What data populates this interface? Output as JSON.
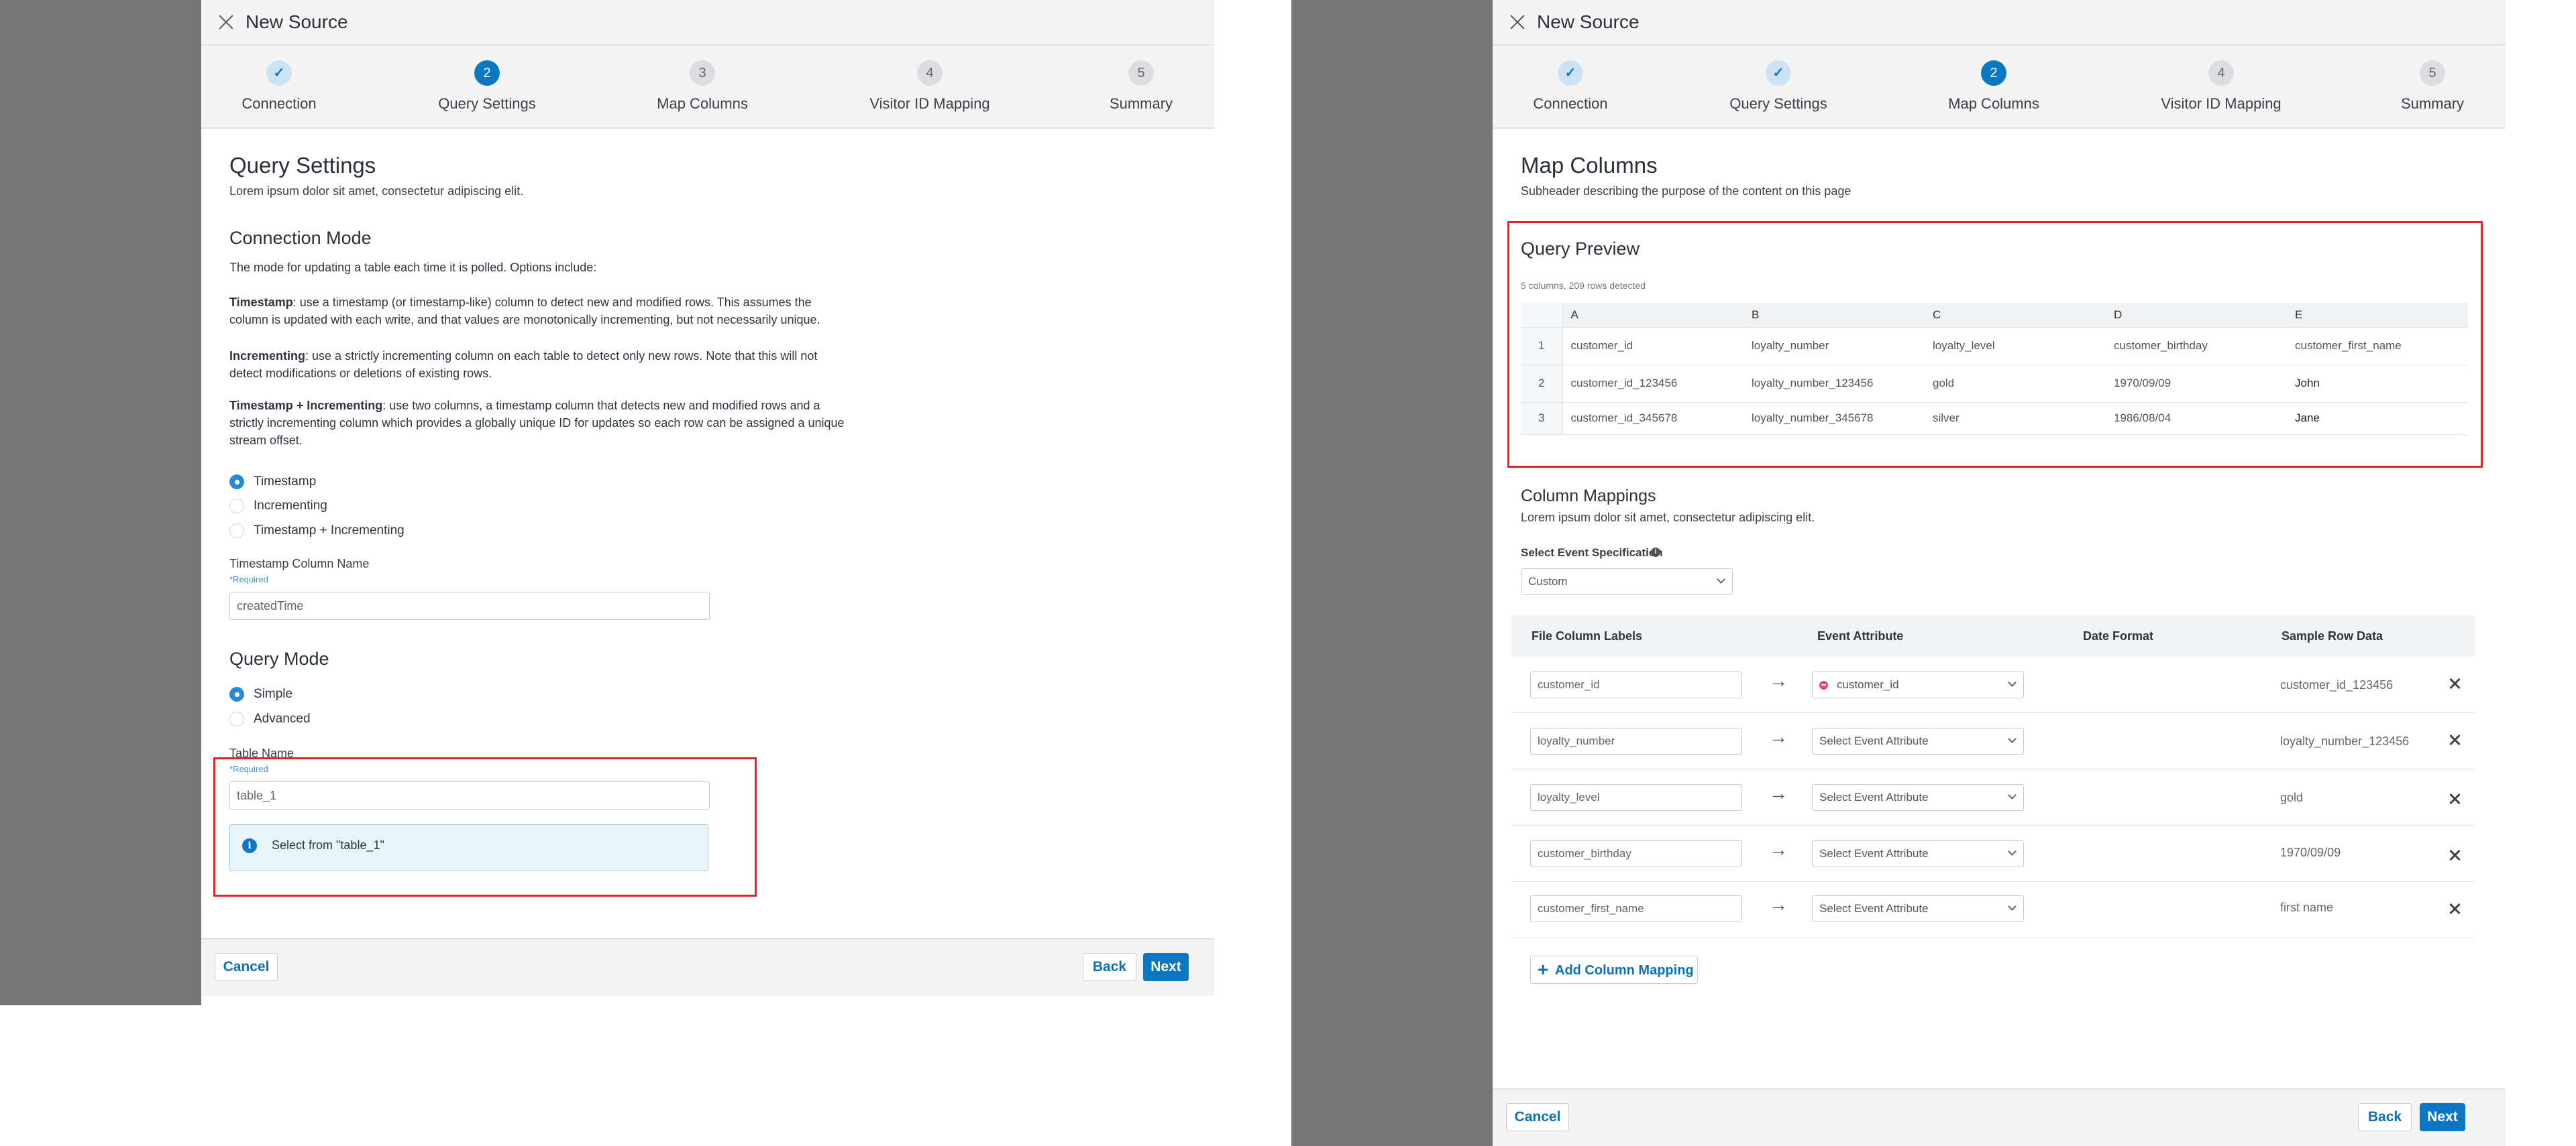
{
  "left": {
    "title": "New Source",
    "steps": [
      {
        "num": "✓",
        "label": "Connection"
      },
      {
        "num": "2",
        "label": "Query Settings"
      },
      {
        "num": "3",
        "label": "Map Columns"
      },
      {
        "num": "4",
        "label": "Visitor ID Mapping"
      },
      {
        "num": "5",
        "label": "Summary"
      }
    ],
    "heading": "Query Settings",
    "subheading": "Lorem ipsum dolor sit amet, consectetur adipiscing elit.",
    "connection_mode": {
      "title": "Connection Mode",
      "intro": "The mode for updating a table each time it is polled. Options include:",
      "p1_bold": "Timestamp",
      "p1_rest": ": use a timestamp (or timestamp-like) column to detect new and modified rows. This assumes the column is updated with each write, and that values are monotonically incrementing, but not necessarily unique.",
      "p2_bold": "Incrementing",
      "p2_rest": ": use a strictly incrementing column on each table to detect only new rows. Note that this will not detect modifications or deletions of existing rows.",
      "p3_bold": "Timestamp + Incrementing",
      "p3_rest": ": use two columns, a timestamp column that detects new and modified rows and a strictly incrementing column which provides a globally unique ID for updates so each row can be assigned a unique stream offset.",
      "options": [
        "Timestamp",
        "Incrementing",
        "Timestamp + Incrementing"
      ]
    },
    "timestamp_field": {
      "label": "Timestamp Column Name",
      "required": "*Required",
      "value": "createdTime"
    },
    "query_mode": {
      "title": "Query Mode",
      "options": [
        "Simple",
        "Advanced"
      ]
    },
    "table_field": {
      "label": "Table Name",
      "required": "*Required",
      "value": "table_1"
    },
    "info_text": "Select from \"table_1\"",
    "cancel": "Cancel",
    "back": "Back",
    "next": "Next"
  },
  "right": {
    "title": "New Source",
    "steps": [
      {
        "num": "✓",
        "label": "Connection"
      },
      {
        "num": "✓",
        "label": "Query Settings"
      },
      {
        "num": "2",
        "label": "Map Columns"
      },
      {
        "num": "4",
        "label": "Visitor ID Mapping"
      },
      {
        "num": "5",
        "label": "Summary"
      }
    ],
    "heading": "Map Columns",
    "subheading": "Subheader describing the purpose of the content on this page",
    "preview": {
      "title": "Query Preview",
      "meta": "5 columns, 209 rows detected",
      "columns": [
        "A",
        "B",
        "C",
        "D",
        "E"
      ],
      "rows": [
        {
          "n": "1",
          "cells": [
            "customer_id",
            "loyalty_number",
            "loyalty_level",
            "customer_birthday",
            "customer_first_name"
          ]
        },
        {
          "n": "2",
          "cells": [
            "customer_id_123456",
            "loyalty_number_123456",
            "gold",
            "1970/09/09",
            "John"
          ]
        },
        {
          "n": "3",
          "cells": [
            "customer_id_345678",
            "loyalty_number_345678",
            "silver",
            "1986/08/04",
            "Jane"
          ]
        }
      ]
    },
    "mappings": {
      "title": "Column Mappings",
      "subtitle": "Lorem ipsum dolor sit amet, consectetur adipiscing elit.",
      "spec_label": "Select Event Specification",
      "spec_value": "Custom",
      "headers": [
        "File Column Labels",
        "Event Attribute",
        "Date Format",
        "Sample Row Data"
      ],
      "rows": [
        {
          "label": "customer_id",
          "attr": "customer_id",
          "sample": "customer_id_123456"
        },
        {
          "label": "loyalty_number",
          "attr": "Select Event Attribute",
          "sample": "loyalty_number_123456"
        },
        {
          "label": "loyalty_level",
          "attr": "Select Event Attribute",
          "sample": "gold"
        },
        {
          "label": "customer_birthday",
          "attr": "Select Event Attribute",
          "sample": "1970/09/09"
        },
        {
          "label": "customer_first_name",
          "attr": "Select Event Attribute",
          "sample": "first name"
        }
      ],
      "add_label": "Add Column Mapping"
    },
    "cancel": "Cancel",
    "back": "Back",
    "next": "Next"
  }
}
